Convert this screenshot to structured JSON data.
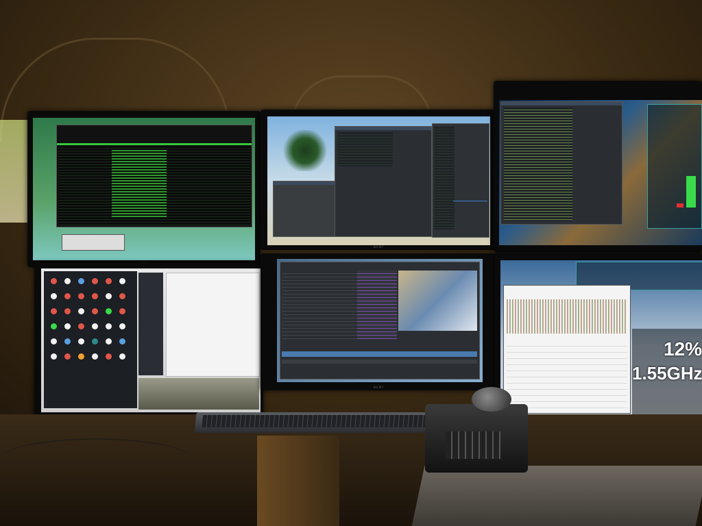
{
  "scene": {
    "monitor_brand": "acer",
    "cpu_overlay": {
      "usage": "12%",
      "frequency": "1.55GHz"
    },
    "colors": {
      "bezel": "#0a0a0a",
      "wall": "#3d2c14",
      "terminal_green": "#35c93b",
      "editor_dark": "#2b2f33",
      "desktop_teal": "#2f8a8a",
      "accent_blue": "#3d7fd0"
    }
  }
}
